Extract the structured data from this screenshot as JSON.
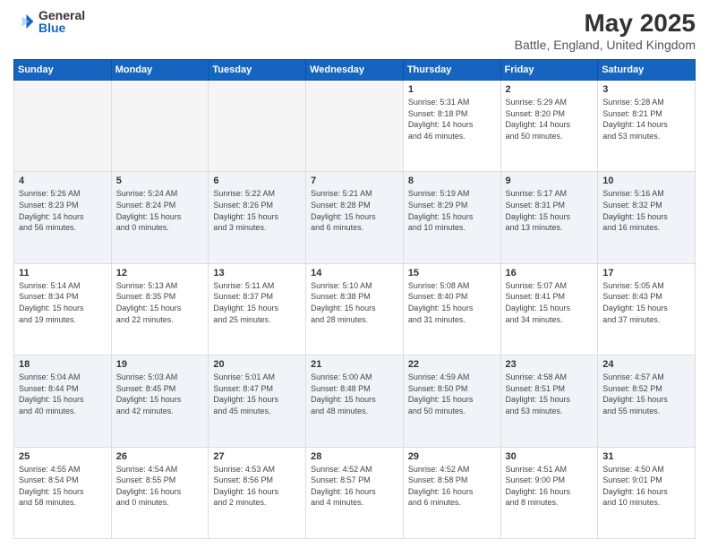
{
  "logo": {
    "general": "General",
    "blue": "Blue"
  },
  "title": "May 2025",
  "subtitle": "Battle, England, United Kingdom",
  "days_header": [
    "Sunday",
    "Monday",
    "Tuesday",
    "Wednesday",
    "Thursday",
    "Friday",
    "Saturday"
  ],
  "weeks": [
    [
      {
        "day": "",
        "empty": true
      },
      {
        "day": "",
        "empty": true
      },
      {
        "day": "",
        "empty": true
      },
      {
        "day": "",
        "empty": true
      },
      {
        "day": "1",
        "info": "Sunrise: 5:31 AM\nSunset: 8:18 PM\nDaylight: 14 hours\nand 46 minutes."
      },
      {
        "day": "2",
        "info": "Sunrise: 5:29 AM\nSunset: 8:20 PM\nDaylight: 14 hours\nand 50 minutes."
      },
      {
        "day": "3",
        "info": "Sunrise: 5:28 AM\nSunset: 8:21 PM\nDaylight: 14 hours\nand 53 minutes."
      }
    ],
    [
      {
        "day": "4",
        "info": "Sunrise: 5:26 AM\nSunset: 8:23 PM\nDaylight: 14 hours\nand 56 minutes."
      },
      {
        "day": "5",
        "info": "Sunrise: 5:24 AM\nSunset: 8:24 PM\nDaylight: 15 hours\nand 0 minutes."
      },
      {
        "day": "6",
        "info": "Sunrise: 5:22 AM\nSunset: 8:26 PM\nDaylight: 15 hours\nand 3 minutes."
      },
      {
        "day": "7",
        "info": "Sunrise: 5:21 AM\nSunset: 8:28 PM\nDaylight: 15 hours\nand 6 minutes."
      },
      {
        "day": "8",
        "info": "Sunrise: 5:19 AM\nSunset: 8:29 PM\nDaylight: 15 hours\nand 10 minutes."
      },
      {
        "day": "9",
        "info": "Sunrise: 5:17 AM\nSunset: 8:31 PM\nDaylight: 15 hours\nand 13 minutes."
      },
      {
        "day": "10",
        "info": "Sunrise: 5:16 AM\nSunset: 8:32 PM\nDaylight: 15 hours\nand 16 minutes."
      }
    ],
    [
      {
        "day": "11",
        "info": "Sunrise: 5:14 AM\nSunset: 8:34 PM\nDaylight: 15 hours\nand 19 minutes."
      },
      {
        "day": "12",
        "info": "Sunrise: 5:13 AM\nSunset: 8:35 PM\nDaylight: 15 hours\nand 22 minutes."
      },
      {
        "day": "13",
        "info": "Sunrise: 5:11 AM\nSunset: 8:37 PM\nDaylight: 15 hours\nand 25 minutes."
      },
      {
        "day": "14",
        "info": "Sunrise: 5:10 AM\nSunset: 8:38 PM\nDaylight: 15 hours\nand 28 minutes."
      },
      {
        "day": "15",
        "info": "Sunrise: 5:08 AM\nSunset: 8:40 PM\nDaylight: 15 hours\nand 31 minutes."
      },
      {
        "day": "16",
        "info": "Sunrise: 5:07 AM\nSunset: 8:41 PM\nDaylight: 15 hours\nand 34 minutes."
      },
      {
        "day": "17",
        "info": "Sunrise: 5:05 AM\nSunset: 8:43 PM\nDaylight: 15 hours\nand 37 minutes."
      }
    ],
    [
      {
        "day": "18",
        "info": "Sunrise: 5:04 AM\nSunset: 8:44 PM\nDaylight: 15 hours\nand 40 minutes."
      },
      {
        "day": "19",
        "info": "Sunrise: 5:03 AM\nSunset: 8:45 PM\nDaylight: 15 hours\nand 42 minutes."
      },
      {
        "day": "20",
        "info": "Sunrise: 5:01 AM\nSunset: 8:47 PM\nDaylight: 15 hours\nand 45 minutes."
      },
      {
        "day": "21",
        "info": "Sunrise: 5:00 AM\nSunset: 8:48 PM\nDaylight: 15 hours\nand 48 minutes."
      },
      {
        "day": "22",
        "info": "Sunrise: 4:59 AM\nSunset: 8:50 PM\nDaylight: 15 hours\nand 50 minutes."
      },
      {
        "day": "23",
        "info": "Sunrise: 4:58 AM\nSunset: 8:51 PM\nDaylight: 15 hours\nand 53 minutes."
      },
      {
        "day": "24",
        "info": "Sunrise: 4:57 AM\nSunset: 8:52 PM\nDaylight: 15 hours\nand 55 minutes."
      }
    ],
    [
      {
        "day": "25",
        "info": "Sunrise: 4:55 AM\nSunset: 8:54 PM\nDaylight: 15 hours\nand 58 minutes."
      },
      {
        "day": "26",
        "info": "Sunrise: 4:54 AM\nSunset: 8:55 PM\nDaylight: 16 hours\nand 0 minutes."
      },
      {
        "day": "27",
        "info": "Sunrise: 4:53 AM\nSunset: 8:56 PM\nDaylight: 16 hours\nand 2 minutes."
      },
      {
        "day": "28",
        "info": "Sunrise: 4:52 AM\nSunset: 8:57 PM\nDaylight: 16 hours\nand 4 minutes."
      },
      {
        "day": "29",
        "info": "Sunrise: 4:52 AM\nSunset: 8:58 PM\nDaylight: 16 hours\nand 6 minutes."
      },
      {
        "day": "30",
        "info": "Sunrise: 4:51 AM\nSunset: 9:00 PM\nDaylight: 16 hours\nand 8 minutes."
      },
      {
        "day": "31",
        "info": "Sunrise: 4:50 AM\nSunset: 9:01 PM\nDaylight: 16 hours\nand 10 minutes."
      }
    ]
  ]
}
